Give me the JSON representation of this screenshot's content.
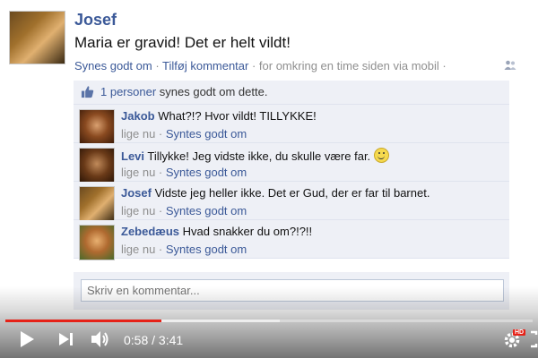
{
  "post": {
    "author": "Josef",
    "status": "Maria er gravid! Det er helt vildt!",
    "actions": {
      "like": "Synes godt om",
      "separator1": " · ",
      "comment": "Tilføj kommentar",
      "separator2": " · ",
      "time": "for omkring en time siden via mobil",
      "separator3": " · "
    }
  },
  "likes": {
    "count_label": "1 personer",
    "suffix": " synes godt om dette."
  },
  "comments": [
    {
      "name": "Jakob",
      "text": " What?!? Hvor vildt! TILLYKKE!",
      "time": "lige nu",
      "sep": " · ",
      "like": "Syntes godt om"
    },
    {
      "name": "Levi",
      "text": " Tillykke! Jeg vidste ikke, du skulle være far.",
      "time": "lige nu",
      "sep": " · ",
      "like": "Syntes godt om"
    },
    {
      "name": "Josef",
      "text": " Vidste jeg heller ikke. Det er Gud, der er far til barnet.",
      "time": "lige nu",
      "sep": " · ",
      "like": "Syntes godt om"
    },
    {
      "name": "Zebedæus",
      "text": " Hvad snakker du om?!?!!",
      "time": "lige nu",
      "sep": " · ",
      "like": "Syntes godt om"
    }
  ],
  "comment_box": {
    "placeholder": "Skriv en kommentar..."
  },
  "player": {
    "current_time": "0:58",
    "time_separator": " / ",
    "duration": "3:41",
    "progress": 0.296,
    "buffered": 0.52,
    "hd_badge": "HD",
    "accent_color": "#e62117"
  },
  "colors": {
    "link": "#3b5998",
    "comment_bg": "#eef0f6"
  }
}
